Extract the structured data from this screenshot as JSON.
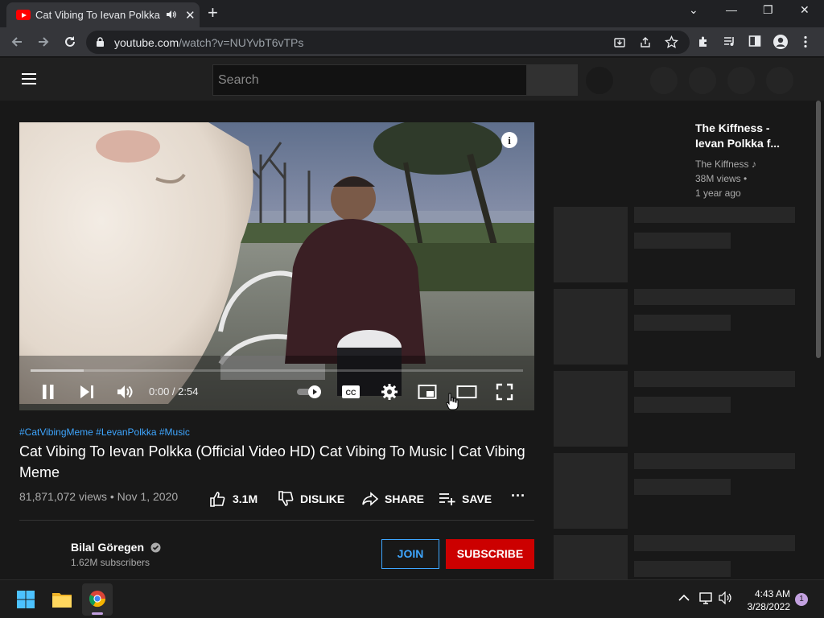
{
  "browser": {
    "tab_title": "Cat Vibing To Ievan Polkka (C",
    "tab_close": "✕",
    "new_tab": "+",
    "url_host": "youtube.com",
    "url_path": "/watch?v=NUYvbT6vTPs",
    "window_controls": [
      "⌄",
      "—",
      "❐",
      "✕"
    ]
  },
  "youtube": {
    "search_placeholder": "Search"
  },
  "video": {
    "time": "0:00 / 2:54",
    "progress_fraction": 0.0,
    "hashtags": "#CatVibingMeme #LevanPolkka #Music",
    "title": "Cat Vibing To Ievan Polkka (Official Video HD) Cat Vibing To Music | Cat Vibing Meme",
    "views_date": "81,871,072 views • Nov 1, 2020",
    "likes": "3.1M",
    "dislike": "DISLIKE",
    "share": "SHARE",
    "save": "SAVE",
    "more": "···"
  },
  "channel": {
    "name": "Bilal Göregen",
    "subscribers": "1.62M subscribers",
    "join": "JOIN",
    "subscribe": "SUBSCRIBE"
  },
  "sidebar": {
    "rec_title": "The Kiffness - Ievan Polkka f...",
    "rec_channel": "The Kiffness ♪",
    "rec_views": "38M views •",
    "rec_age": "1 year ago"
  },
  "taskbar": {
    "time": "4:43 AM",
    "date": "3/28/2022",
    "notifications": "1"
  },
  "colors": {
    "subscribe_red": "#cc0000",
    "link_blue": "#3ea6ff",
    "background": "#181818"
  }
}
